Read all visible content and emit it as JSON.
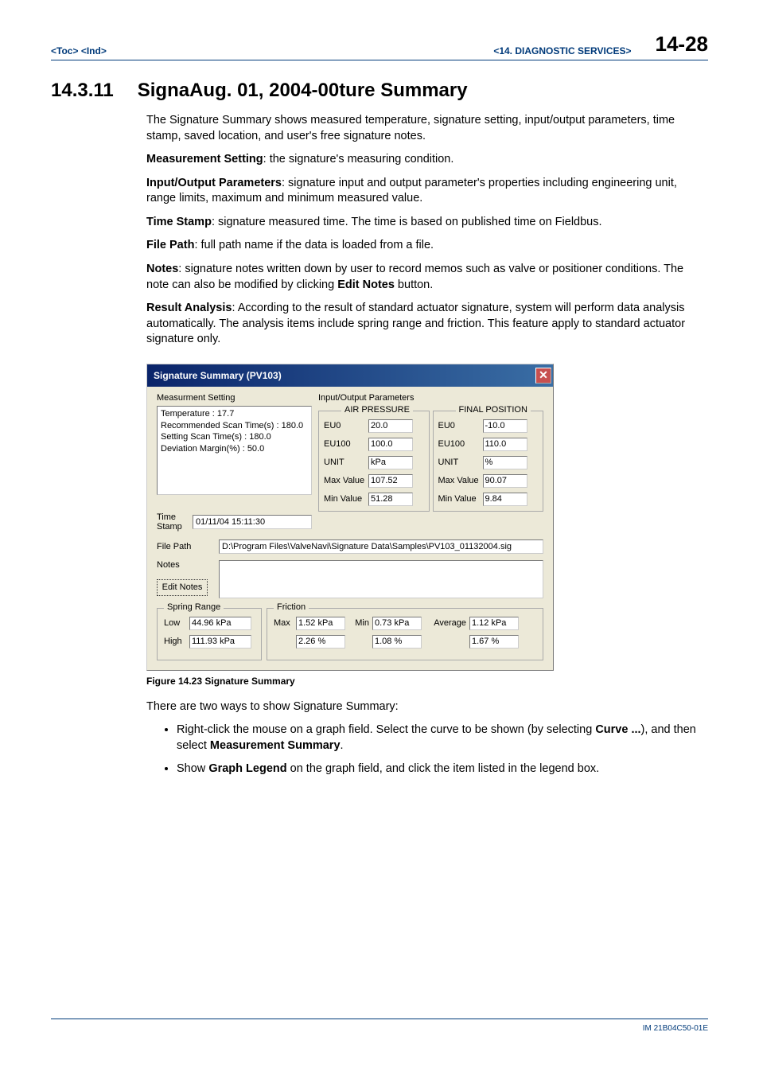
{
  "header": {
    "toc": "<Toc>",
    "ind": "<Ind>",
    "chapter": "<14.  DIAGNOSTIC SERVICES>",
    "pageNum": "14-28"
  },
  "title": {
    "num": "14.3.11",
    "text": "SignaAug. 01, 2004-00ture Summary"
  },
  "paras": {
    "intro": "The Signature Summary shows measured temperature, signature setting, input/output parameters, time stamp, saved location, and user's free signature notes.",
    "ms_label": "Measurement Setting",
    "ms_rest": ": the signature's measuring condition.",
    "io_label": "Input/Output Parameters",
    "io_rest": ": signature input and output parameter's properties including engineering unit, range limits, maximum and minimum measured value.",
    "ts_label": "Time Stamp",
    "ts_rest": ": signature measured time.  The time is based on published time on Fieldbus.",
    "fp_label": "File Path",
    "fp_rest": ": full path name if the data is loaded from a file.",
    "notes_label": "Notes",
    "notes_rest_a": ": signature notes written down by user to record memos such as valve or positioner conditions. The note can also be modified by clicking ",
    "notes_rest_b": "Edit Notes",
    "notes_rest_c": " button.",
    "ra_label": "Result Analysis",
    "ra_rest": ": According to the result of standard actuator signature, system will perform data analysis automatically. The analysis items include spring range and friction. This feature apply to standard actuator signature only."
  },
  "dialog": {
    "title": "Signature Summary (PV103)",
    "measSettingLabel": "Measurment Setting",
    "ioParamsLabel": "Input/Output Parameters",
    "measText": {
      "l1": "Temperature : 17.7",
      "l2": "Recommended Scan Time(s) : 180.0",
      "l3": "Setting Scan Time(s) : 180.0",
      "l4": "Deviation Margin(%) : 50.0"
    },
    "timeStampLabel": "Time Stamp",
    "timeStampValue": "01/11/04 15:11:30",
    "airPressure": {
      "legend": "AIR PRESSURE",
      "rows": [
        {
          "label": "EU0",
          "value": "20.0"
        },
        {
          "label": "EU100",
          "value": "100.0"
        },
        {
          "label": "UNIT",
          "value": "kPa"
        },
        {
          "label": "Max Value",
          "value": "107.52"
        },
        {
          "label": "Min Value",
          "value": "51.28"
        }
      ]
    },
    "finalPosition": {
      "legend": "FINAL POSITION",
      "rows": [
        {
          "label": "EU0",
          "value": "-10.0"
        },
        {
          "label": "EU100",
          "value": "110.0"
        },
        {
          "label": "UNIT",
          "value": "%"
        },
        {
          "label": "Max Value",
          "value": "90.07"
        },
        {
          "label": "Min Value",
          "value": "9.84"
        }
      ]
    },
    "filePathLabel": "File Path",
    "filePathValue": "D:\\Program Files\\ValveNavi\\Signature Data\\Samples\\PV103_01132004.sig",
    "notesLabel": "Notes",
    "editNotesLabel": "Edit Notes",
    "springRange": {
      "legend": "Spring Range",
      "lowLabel": "Low",
      "lowValue": "44.96 kPa",
      "highLabel": "High",
      "highValue": "111.93 kPa"
    },
    "friction": {
      "legend": "Friction",
      "maxLabel": "Max",
      "maxValue": "1.52 kPa",
      "maxPct": "2.26 %",
      "minLabel": "Min",
      "minValue": "0.73 kPa",
      "minPct": "1.08 %",
      "avgLabel": "Average",
      "avgValue": "1.12 kPa",
      "avgPct": "1.67 %"
    }
  },
  "figCaption": "Figure 14.23  Signature Summary",
  "below": {
    "intro": "There are two ways to show Signature Summary:",
    "b1a": "Right-click the mouse on a graph field.  Select the curve to be shown (by selecting ",
    "b1b": "Curve ...",
    "b1c": "), and then select ",
    "b1d": "Measurement Summary",
    "b1e": ".",
    "b2a": "Show ",
    "b2b": "Graph Legend",
    "b2c": " on the graph field, and click the item listed in the legend box."
  },
  "footer": "IM 21B04C50-01E"
}
